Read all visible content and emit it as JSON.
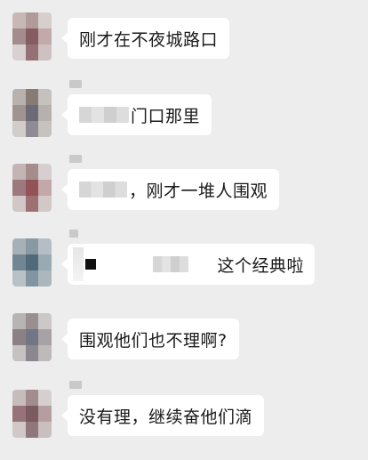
{
  "messages": [
    {
      "text": "刚才在不夜城路口",
      "avatar_colors": [
        "#c9b7b5",
        "#b49a99",
        "#d7cfcd",
        "#a88a8c",
        "#8b5a60",
        "#c5a9aa",
        "#d8d2d1",
        "#9a6f74",
        "#cfc2c0"
      ]
    },
    {
      "text": "门口那里",
      "avatar_colors": [
        "#b9b2ad",
        "#8a7a72",
        "#c6c1bd",
        "#a2948f",
        "#6d6a7a",
        "#b7b0ad",
        "#d2cdca",
        "#8f8b95",
        "#c7c2bf"
      ]
    },
    {
      "text": "，刚才一堆人围观",
      "avatar_colors": [
        "#c6b3b3",
        "#a98c8c",
        "#d8cfcf",
        "#a0787c",
        "#9b4f56",
        "#c8a7a8",
        "#d1c7c6",
        "#a36f73",
        "#d3c8c7"
      ]
    },
    {
      "text": "这个经典啦",
      "avatar_colors": [
        "#a4b0b9",
        "#8599a6",
        "#b5bec6",
        "#6e8796",
        "#4d6a7c",
        "#98aab6",
        "#b9c1c7",
        "#7e96a3",
        "#aab6bf"
      ]
    },
    {
      "text": "围观他们也不理啊?",
      "avatar_colors": [
        "#b9b4b4",
        "#9a8f90",
        "#cdc8c8",
        "#8f7f84",
        "#6f7686",
        "#aaa2a4",
        "#c7c2c2",
        "#8b8790",
        "#bfbaba"
      ]
    },
    {
      "text": "没有理，继续奋他们滴",
      "avatar_colors": [
        "#c9bcbc",
        "#a68b8d",
        "#d7cfcf",
        "#9b7277",
        "#7d5a60",
        "#b99da0",
        "#d2c8c8",
        "#93767b",
        "#cbbfbf"
      ]
    }
  ]
}
